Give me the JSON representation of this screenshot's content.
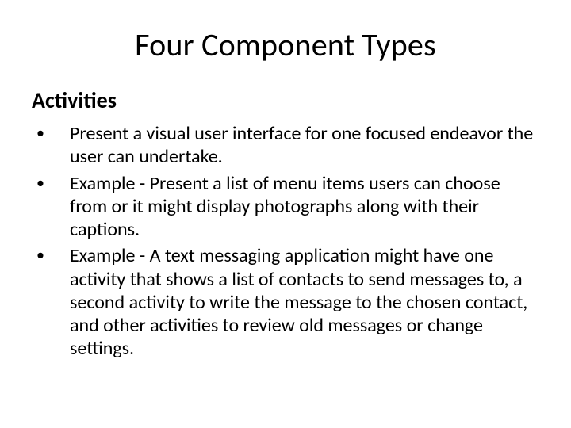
{
  "title": "Four Component Types",
  "subheading": "Activities",
  "bullets": [
    "Present a visual user interface for one focused endeavor the user can undertake.",
    "Example - Present a list of menu items users can choose from or it might display photographs along with their captions.",
    "Example - A text messaging application might have one activity that shows a list of contacts to send messages to, a second activity to write the message to the chosen contact, and other activities to review old messages or change settings."
  ]
}
